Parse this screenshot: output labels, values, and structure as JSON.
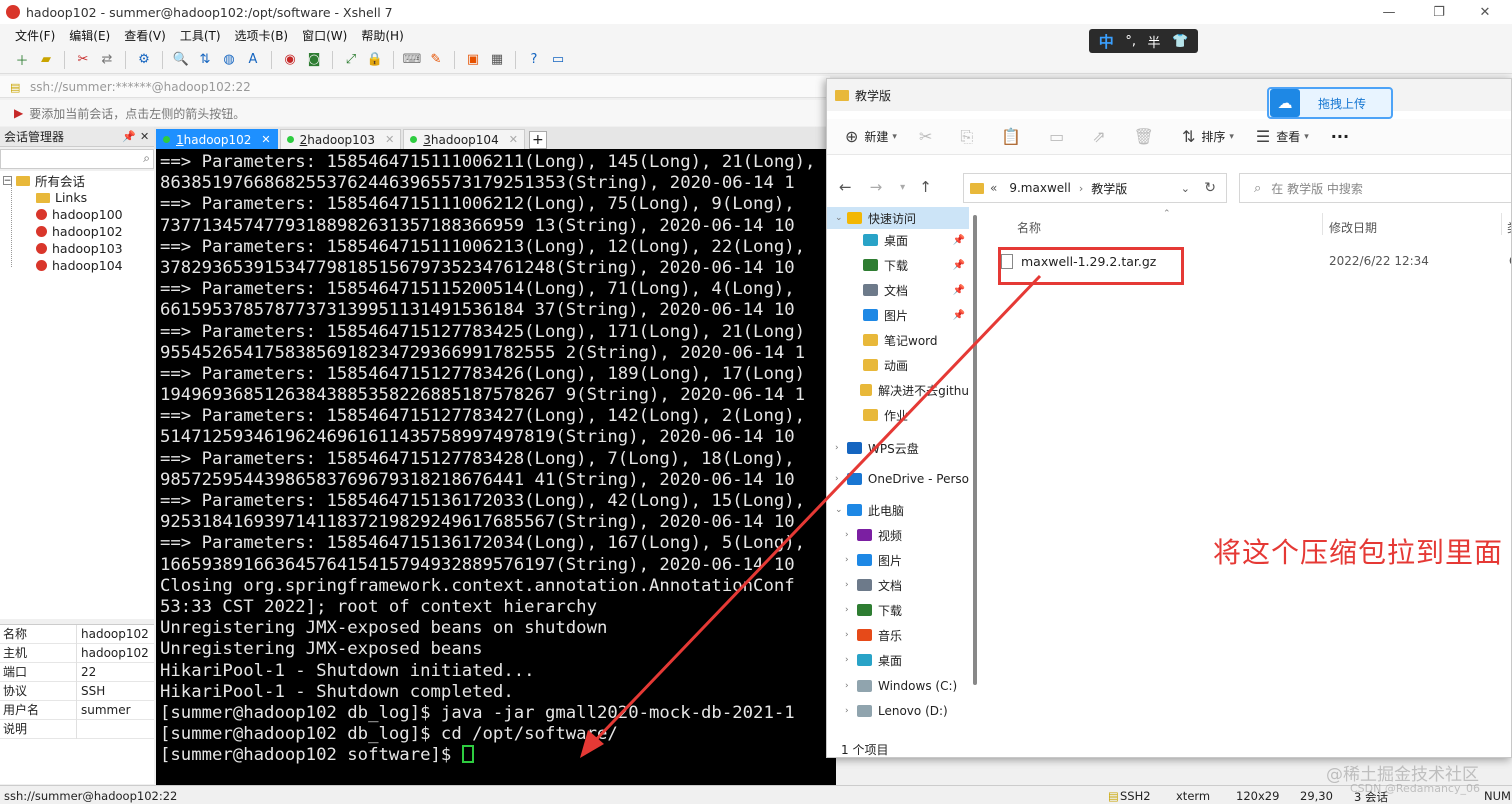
{
  "window": {
    "title": "hadoop102 - summer@hadoop102:/opt/software - Xshell 7",
    "minimize": "—",
    "maximize": "❐",
    "close": "✕"
  },
  "menu": [
    "文件(F)",
    "编辑(E)",
    "查看(V)",
    "工具(T)",
    "选项卡(B)",
    "窗口(W)",
    "帮助(H)"
  ],
  "address": "ssh://summer:******@hadoop102:22",
  "hint": "要添加当前会话，点击左侧的箭头按钮。",
  "ime": {
    "lang": "中",
    "punct": "°,",
    "width": "半",
    "skin": "👕"
  },
  "session_manager": {
    "title": "会话管理器",
    "pin": "📌",
    "close": "✕",
    "tree": {
      "root": "所有会话",
      "items": [
        "Links",
        "hadoop100",
        "hadoop102",
        "hadoop103",
        "hadoop104"
      ]
    },
    "props": [
      {
        "k": "名称",
        "v": "hadoop102"
      },
      {
        "k": "主机",
        "v": "hadoop102"
      },
      {
        "k": "端口",
        "v": "22"
      },
      {
        "k": "协议",
        "v": "SSH"
      },
      {
        "k": "用户名",
        "v": "summer"
      },
      {
        "k": "说明",
        "v": ""
      }
    ]
  },
  "tabs": [
    {
      "num": "1",
      "label": " hadoop102",
      "active": true
    },
    {
      "num": "2",
      "label": " hadoop103",
      "active": false
    },
    {
      "num": "3",
      "label": " hadoop104",
      "active": false
    }
  ],
  "terminal": {
    "lines": [
      "==> Parameters: 1585464715111006211(Long), 145(Long), 21(Long), ",
      "86385197668682553762446396557317925135​3(String), 2020-06-14 1",
      "==> Parameters: 1585464715111006212(Long), 75(Long), 9(Long), ",
      "73771345747793188982631357188366959 13(String), 2020-06-14 10",
      "==> Parameters: 1585464715111006213(Long), 12(Long), 22(Long),",
      "37829365391534779818515679735234761248(String), 2020-06-14 10",
      "==> Parameters: 1585464715115200514(Long), 71(Long), 4(Long), ",
      "66159537857877373139951131491536184 37(String), 2020-06-14 10",
      "==> Parameters: 1585464715127783425(Long), 171(Long), 21(Long)",
      "95545265417583856918234729366991782555 2(String), 2020-06-14 1",
      "==> Parameters: 1585464715127783426(Long), 189(Long), 17(Long)",
      "19496936851263843885358226885187578267 9(String), 2020-06-14 1",
      "==> Parameters: 1585464715127783427(Long), 142(Long), 2(Long),",
      "51471259346196246961611435758997497819(String), 2020-06-14 10",
      "==> Parameters: 1585464715127783428(Long), 7(Long), 18(Long), ",
      "98572595443986583769679318218676441 41(String), 2020-06-14 10",
      "==> Parameters: 1585464715136172033(Long), 42(Long), 15(Long),",
      "92531841693971411837219829249617685567(String), 2020-06-14 10",
      "==> Parameters: 1585464715136172034(Long), 167(Long), 5(Long),",
      "16659389166364576415415794932889576197(String), 2020-06-14 10",
      "Closing org.springframework.context.annotation.AnnotationConf",
      "53:33 CST 2022]; root of context hierarchy",
      "Unregistering JMX-exposed beans on shutdown",
      "Unregistering JMX-exposed beans",
      "HikariPool-1 - Shutdown initiated...",
      "HikariPool-1 - Shutdown completed.",
      "[summer@hadoop102 db_log]$ java -jar gmall2020-mock-db-2021-1",
      "[summer@hadoop102 db_log]$ cd /opt/software/",
      "[summer@hadoop102 software]$ "
    ]
  },
  "statusbar": {
    "left": "ssh://summer@hadoop102:22",
    "proto": "SSH2",
    "term": "xterm",
    "size": "120x29",
    "pos": "29,30",
    "sessions": "3 会话",
    "num": "NUM"
  },
  "explorer": {
    "title": "教学版",
    "upload_label": "拖拽上传",
    "cmd": {
      "new": "新建",
      "sort": "排序",
      "view": "查看",
      "more": "···"
    },
    "crumbs": [
      "«",
      "9.maxwell",
      "教学版"
    ],
    "search_placeholder": "在 教学版 中搜索",
    "nav": [
      {
        "label": "快速访问",
        "type": "star",
        "pinned": false
      },
      {
        "label": "桌面",
        "type": "desktop",
        "pinned": true
      },
      {
        "label": "下载",
        "type": "download",
        "pinned": true
      },
      {
        "label": "文档",
        "type": "doc",
        "pinned": true
      },
      {
        "label": "图片",
        "type": "pic",
        "pinned": true
      },
      {
        "label": "笔记word",
        "type": "folder",
        "pinned": false
      },
      {
        "label": "动画",
        "type": "folder",
        "pinned": false
      },
      {
        "label": "解决进不去githu",
        "type": "folder",
        "pinned": false
      },
      {
        "label": "作业",
        "type": "folder",
        "pinned": false
      },
      {
        "label": "WPS云盘",
        "type": "cloud",
        "pinned": false
      },
      {
        "label": "OneDrive - Perso",
        "type": "onedrive",
        "pinned": false
      },
      {
        "label": "此电脑",
        "type": "pc",
        "pinned": false
      },
      {
        "label": "视频",
        "type": "video",
        "pinned": false
      },
      {
        "label": "图片",
        "type": "pic",
        "pinned": false
      },
      {
        "label": "文档",
        "type": "doc",
        "pinned": false
      },
      {
        "label": "下载",
        "type": "download",
        "pinned": false
      },
      {
        "label": "音乐",
        "type": "music",
        "pinned": false
      },
      {
        "label": "桌面",
        "type": "desktop",
        "pinned": false
      },
      {
        "label": "Windows (C:)",
        "type": "drive",
        "pinned": false
      },
      {
        "label": "Lenovo (D:)",
        "type": "drive",
        "pinned": false
      }
    ],
    "columns": {
      "name": "名称",
      "modified": "修改日期",
      "type_cut": "类"
    },
    "file": {
      "name": "maxwell-1.29.2.tar.gz",
      "modified": "2022/6/22 12:34",
      "type_cut": "G"
    },
    "annotation": "将这个压缩包拉到里面",
    "status": "1 个项目"
  },
  "watermark": "@稀土掘金技术社区",
  "watermark2": "CSDN @Redamancy_06",
  "colors": {
    "accent": "#1e90ff",
    "annotation": "#e53935",
    "terminal_bg": "#000000",
    "cursor": "#2ecc40"
  }
}
